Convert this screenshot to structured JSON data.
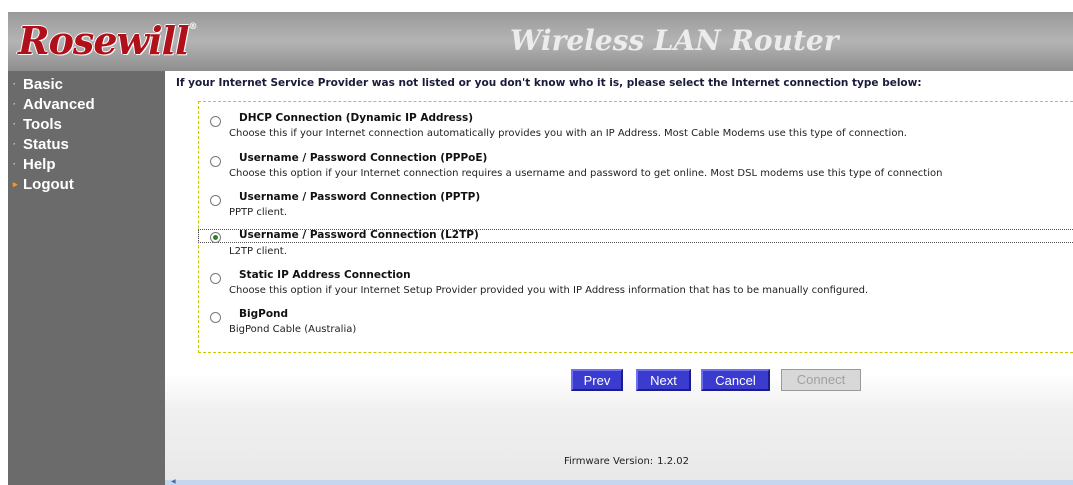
{
  "header": {
    "logo_text": "Rosewill",
    "logo_mark": "®",
    "title": "Wireless LAN Router"
  },
  "sidebar": {
    "items": [
      {
        "label": "Basic",
        "bullet": "·"
      },
      {
        "label": "Advanced",
        "bullet": "·"
      },
      {
        "label": "Tools",
        "bullet": "·"
      },
      {
        "label": "Status",
        "bullet": "·"
      },
      {
        "label": "Help",
        "bullet": "·"
      },
      {
        "label": "Logout",
        "bullet": "▸"
      }
    ]
  },
  "main": {
    "intro": "If your Internet Service Provider was not listed or you don't know who it is, please select the Internet connection type below:",
    "options": [
      {
        "label": "DHCP Connection (Dynamic IP Address)",
        "description": "Choose this if your Internet connection automatically provides you with an IP Address. Most Cable Modems use this type of connection.",
        "selected": false
      },
      {
        "label": "Username / Password Connection (PPPoE)",
        "description": "Choose this option if your Internet connection requires a username and password to get online. Most DSL modems use this type of connection",
        "selected": false
      },
      {
        "label": "Username / Password Connection (PPTP)",
        "description": "PPTP client.",
        "selected": false
      },
      {
        "label": "Username / Password Connection (L2TP)",
        "description": "L2TP client.",
        "selected": true
      },
      {
        "label": "Static IP Address Connection",
        "description": "Choose this option if your Internet Setup Provider provided you with IP Address information that has to be manually configured.",
        "selected": false
      },
      {
        "label": "BigPond",
        "description": "BigPond Cable (Australia)",
        "selected": false
      }
    ],
    "buttons": {
      "prev": "Prev",
      "next": "Next",
      "cancel": "Cancel",
      "connect": "Connect"
    },
    "firmware_label": "Firmware Version:",
    "firmware_version": "1.2.02"
  },
  "colors": {
    "sidebar_bg": "#6b6b6b",
    "button_bg": "#3b3bd0",
    "logo_red": "#b0101a",
    "box_border": "#c8c800"
  }
}
